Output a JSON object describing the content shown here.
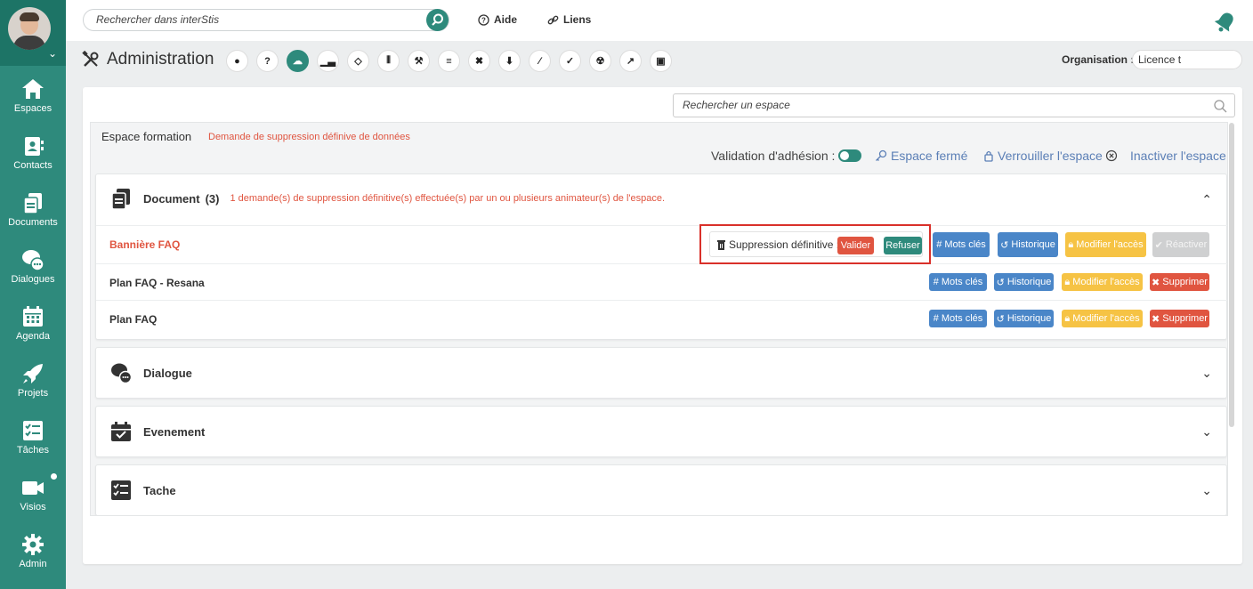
{
  "topbar": {
    "search_placeholder": "Rechercher dans interStis",
    "help_label": "Aide",
    "links_label": "Liens"
  },
  "sidebar": {
    "items": [
      {
        "label": "Espaces",
        "icon": "home-icon"
      },
      {
        "label": "Contacts",
        "icon": "contacts-icon"
      },
      {
        "label": "Documents",
        "icon": "documents-icon"
      },
      {
        "label": "Dialogues",
        "icon": "dialogues-icon"
      },
      {
        "label": "Agenda",
        "icon": "calendar-icon"
      },
      {
        "label": "Projets",
        "icon": "rocket-icon"
      },
      {
        "label": "Tâches",
        "icon": "tasks-icon"
      },
      {
        "label": "Visios",
        "icon": "video-icon"
      },
      {
        "label": "Admin",
        "icon": "gear-icon"
      }
    ]
  },
  "admin": {
    "title": "Administration",
    "tool_icons": [
      "user-icon",
      "help-icon",
      "cloud-icon",
      "chart-icon",
      "tag-icon",
      "sliders-icon",
      "hammer-icon",
      "list-icon",
      "tools-icon",
      "plug-icon",
      "wrench-icon",
      "shield-icon",
      "radiation-icon",
      "export-icon",
      "terminal-icon"
    ],
    "org_label": "Organisation :",
    "org_value": "Licence t"
  },
  "main": {
    "search_placeholder": "Rechercher un espace",
    "space_name": "Espace formation",
    "space_warning": "Demande de suppression définive de données",
    "validation_label": "Validation d'adhésion :",
    "closed_label": "Espace fermé",
    "lock_label": "Verrouiller l'espace",
    "deactivate_label": "Inactiver l'espace",
    "sections": {
      "document": {
        "title": "Document",
        "count": "(3)",
        "note": "1 demande(s) de suppression définitive(s) effectuée(s) par un ou plusieurs animateur(s) de l'espace."
      },
      "dialogue": {
        "title": "Dialogue"
      },
      "evenement": {
        "title": "Evenement"
      },
      "tache": {
        "title": "Tache"
      }
    },
    "documents": [
      {
        "name": "Bannière FAQ"
      },
      {
        "name": "Plan FAQ - Resana"
      },
      {
        "name": "Plan FAQ"
      }
    ],
    "buttons": {
      "suppression_label": "Suppression définitive :",
      "validate": "Valider",
      "refuse": "Refuser",
      "keywords": "Mots clés",
      "history": "Historique",
      "modify_access": "Modifier l'accès",
      "reactivate": "Réactiver",
      "delete": "Supprimer"
    }
  },
  "colors": {
    "brand": "#2e8a7c",
    "danger": "#e05540",
    "info": "#4a86c8",
    "warning": "#f6c344"
  }
}
